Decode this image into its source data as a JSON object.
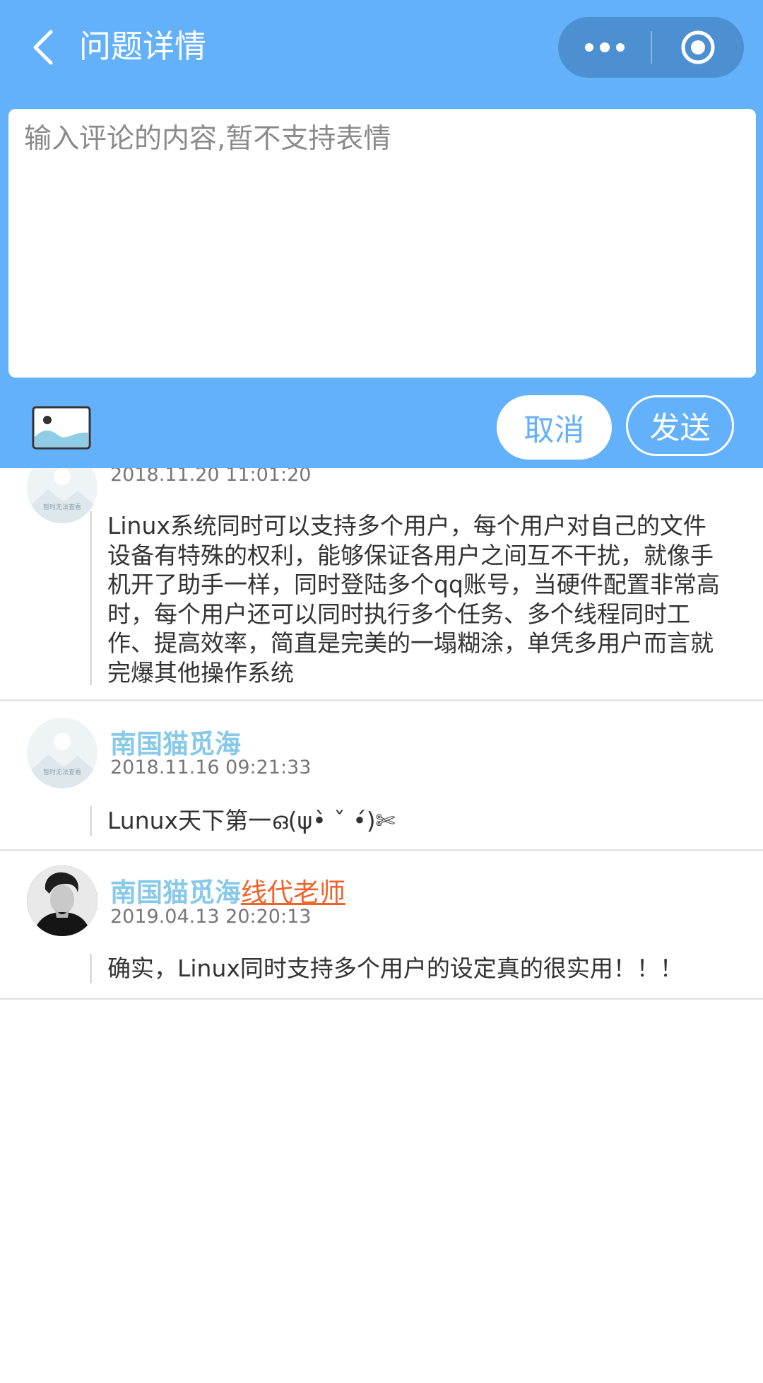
{
  "header": {
    "title": "问题详情"
  },
  "compose": {
    "placeholder": "输入评论的内容,暂不支持表情",
    "cancel_label": "取消",
    "send_label": "发送"
  },
  "avatar_placeholder_text": "暂时无法查看",
  "comments": [
    {
      "timestamp": "2018.11.20 11:01:20",
      "content": "Linux系统同时可以支持多个用户，每个用户对自己的文件设备有特殊的权利，能够保证各用户之间互不干扰，就像手机开了助手一样，同时登陆多个qq账号，当硬件配置非常高时，每个用户还可以同时执行多个任务、多个线程同时工作、提高效率，简直是完美的一塌糊涂，单凭多用户而言就完爆其他操作系统"
    },
    {
      "username": "南国猫觅海",
      "timestamp": "2018.11.16 09:21:33",
      "content": "Lunux天下第一ഒ(ψ•̀ ˇ •́)✄"
    },
    {
      "username": "南国猫觅海",
      "tag": "线代老师",
      "timestamp": "2019.04.13 20:20:13",
      "content": "确实，Linux同时支持多个用户的设定真的很实用！！！"
    }
  ],
  "colors": {
    "primary": "#64b1fb",
    "capsule": "#4d90d1",
    "username": "#87c9e8",
    "tag": "#f0632a"
  },
  "icons": {
    "back": "chevron-left-icon",
    "more": "more-dots-icon",
    "close": "target-circle-icon",
    "image": "image-icon"
  }
}
